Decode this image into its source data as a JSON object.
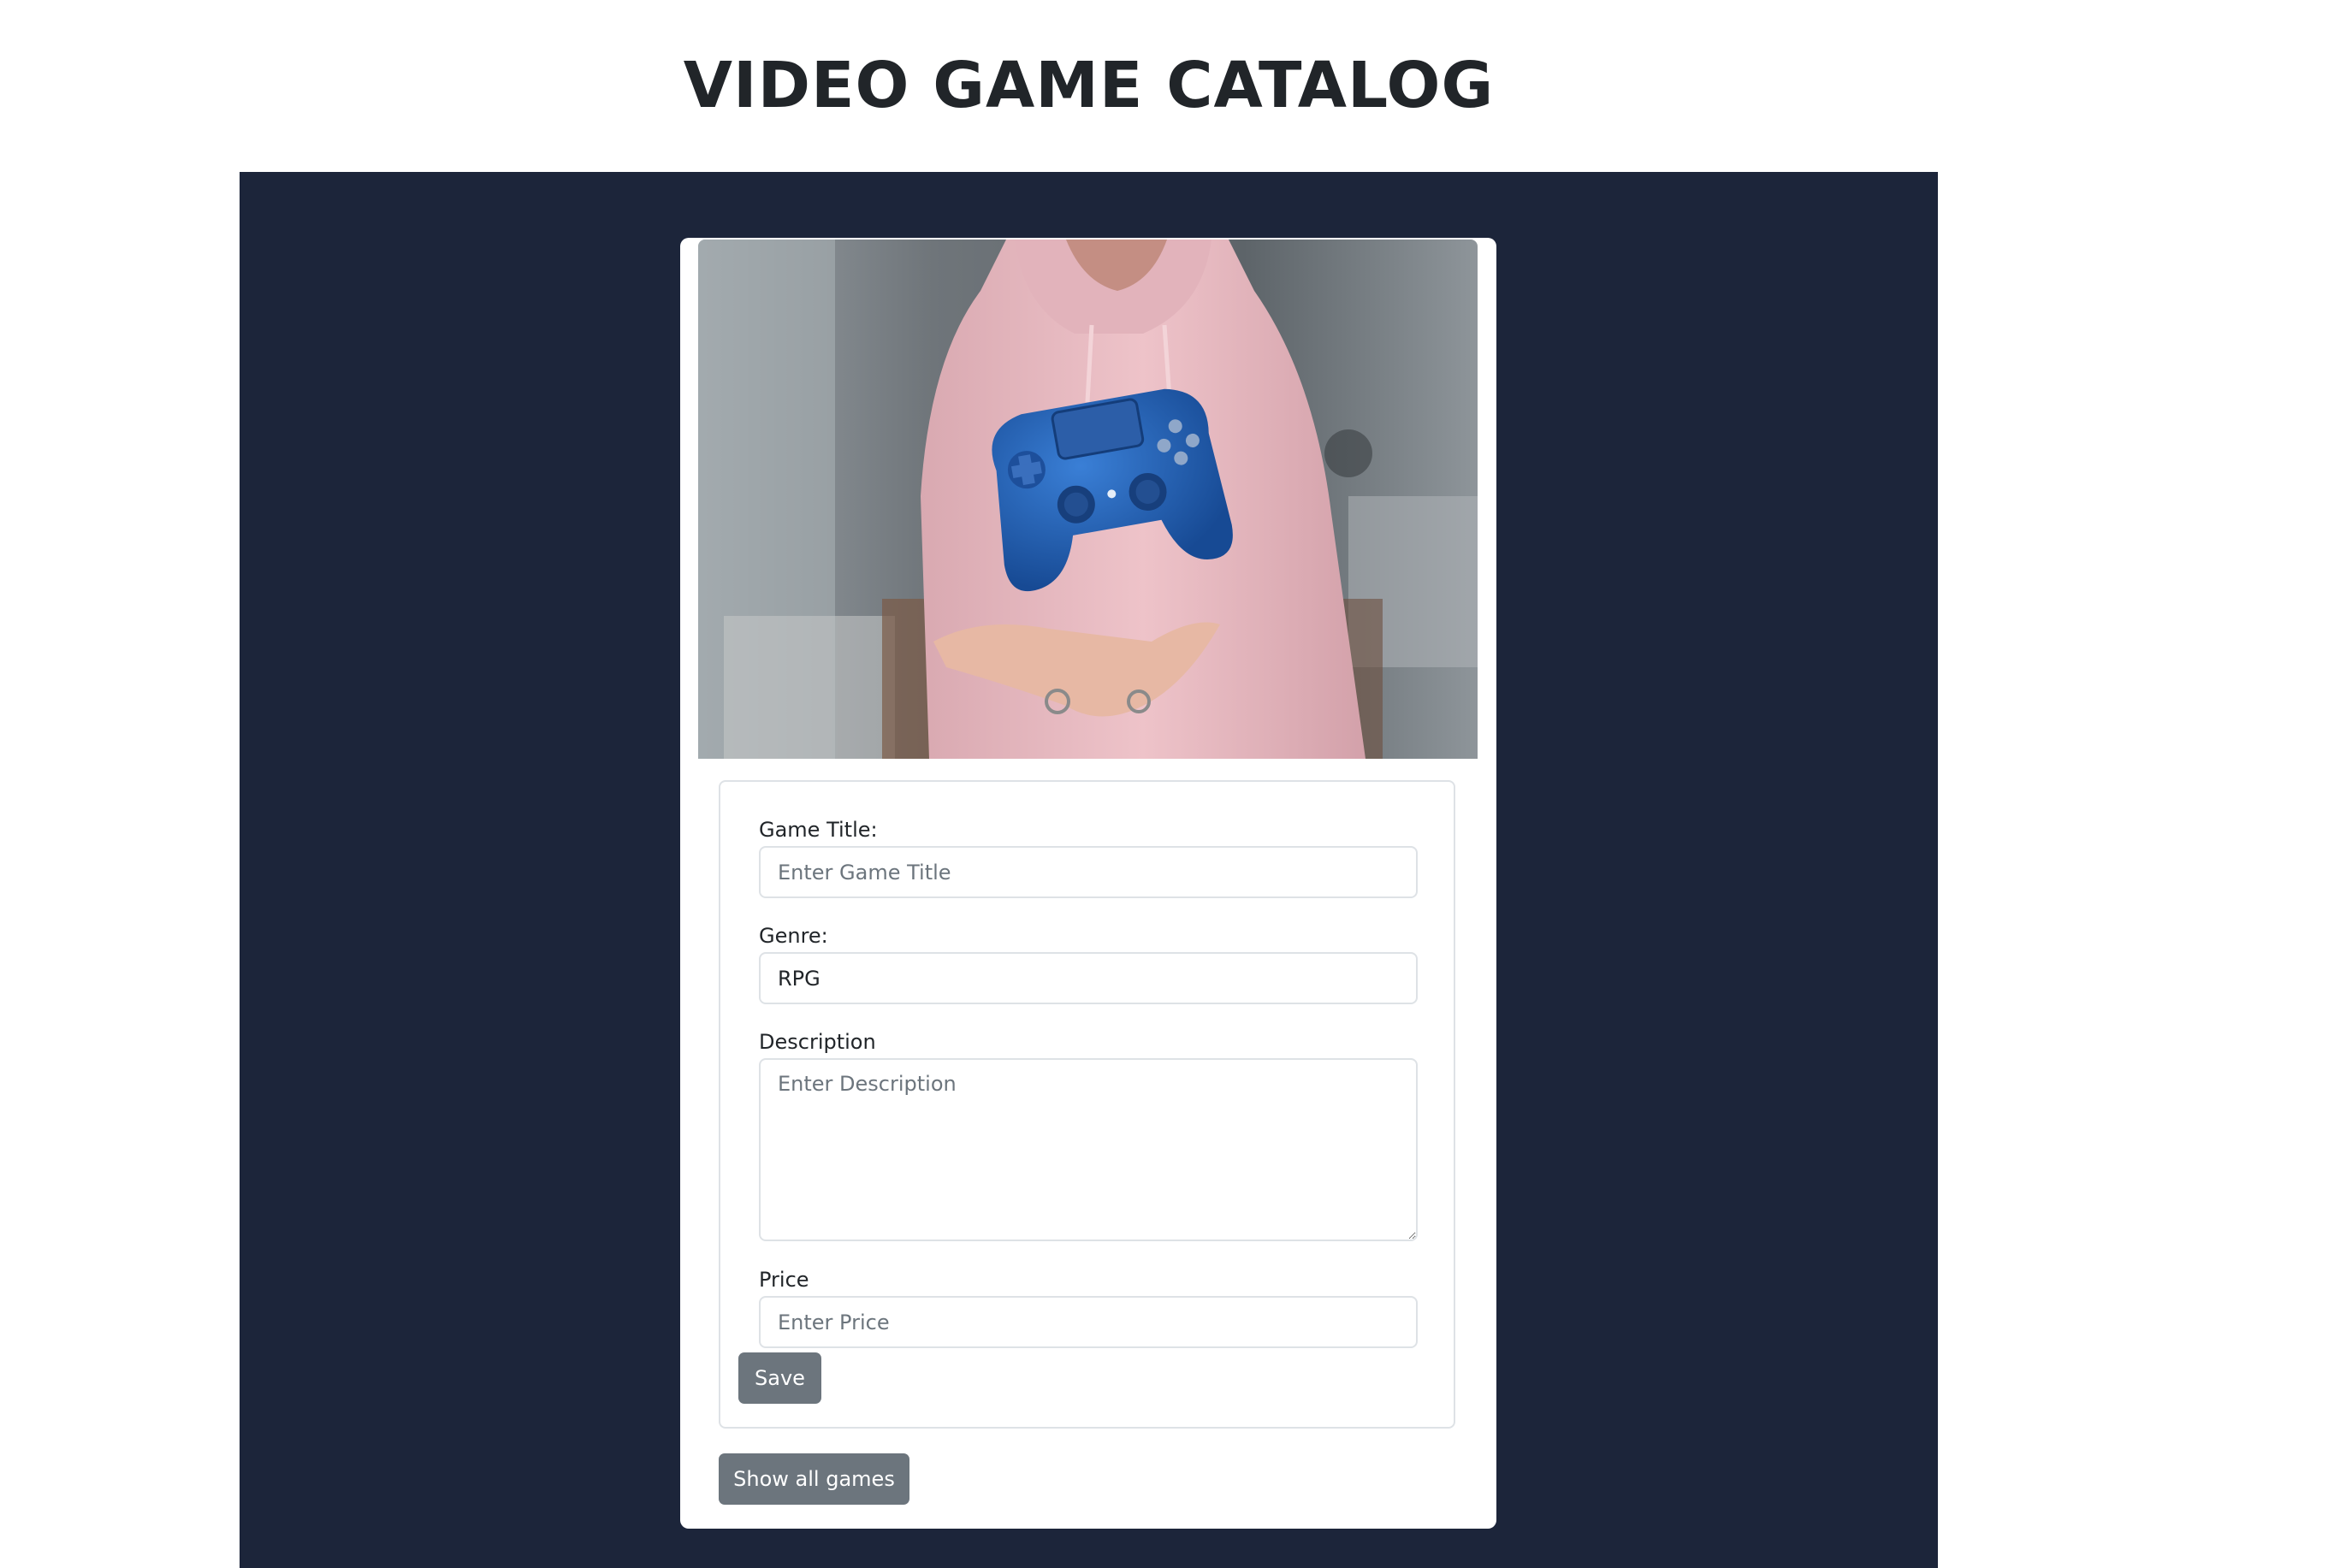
{
  "header": {
    "title": "VIDEO GAME CATALOG"
  },
  "colors": {
    "stage_background": "#1c253a",
    "button": "#6c757d",
    "hoodie": "#e6b9c0",
    "controller": "#1f5fb8"
  },
  "hero": {
    "icon": "game-controller-photo"
  },
  "form": {
    "title_field": {
      "label": "Game Title:",
      "value": "",
      "placeholder": "Enter Game Title"
    },
    "genre_field": {
      "label": "Genre:",
      "value": "RPG",
      "placeholder": ""
    },
    "description_field": {
      "label": "Description",
      "value": "",
      "placeholder": "Enter Description"
    },
    "price_field": {
      "label": "Price",
      "value": "",
      "placeholder": "Enter Price"
    },
    "save_label": "Save"
  },
  "actions": {
    "show_all_label": "Show all games"
  }
}
